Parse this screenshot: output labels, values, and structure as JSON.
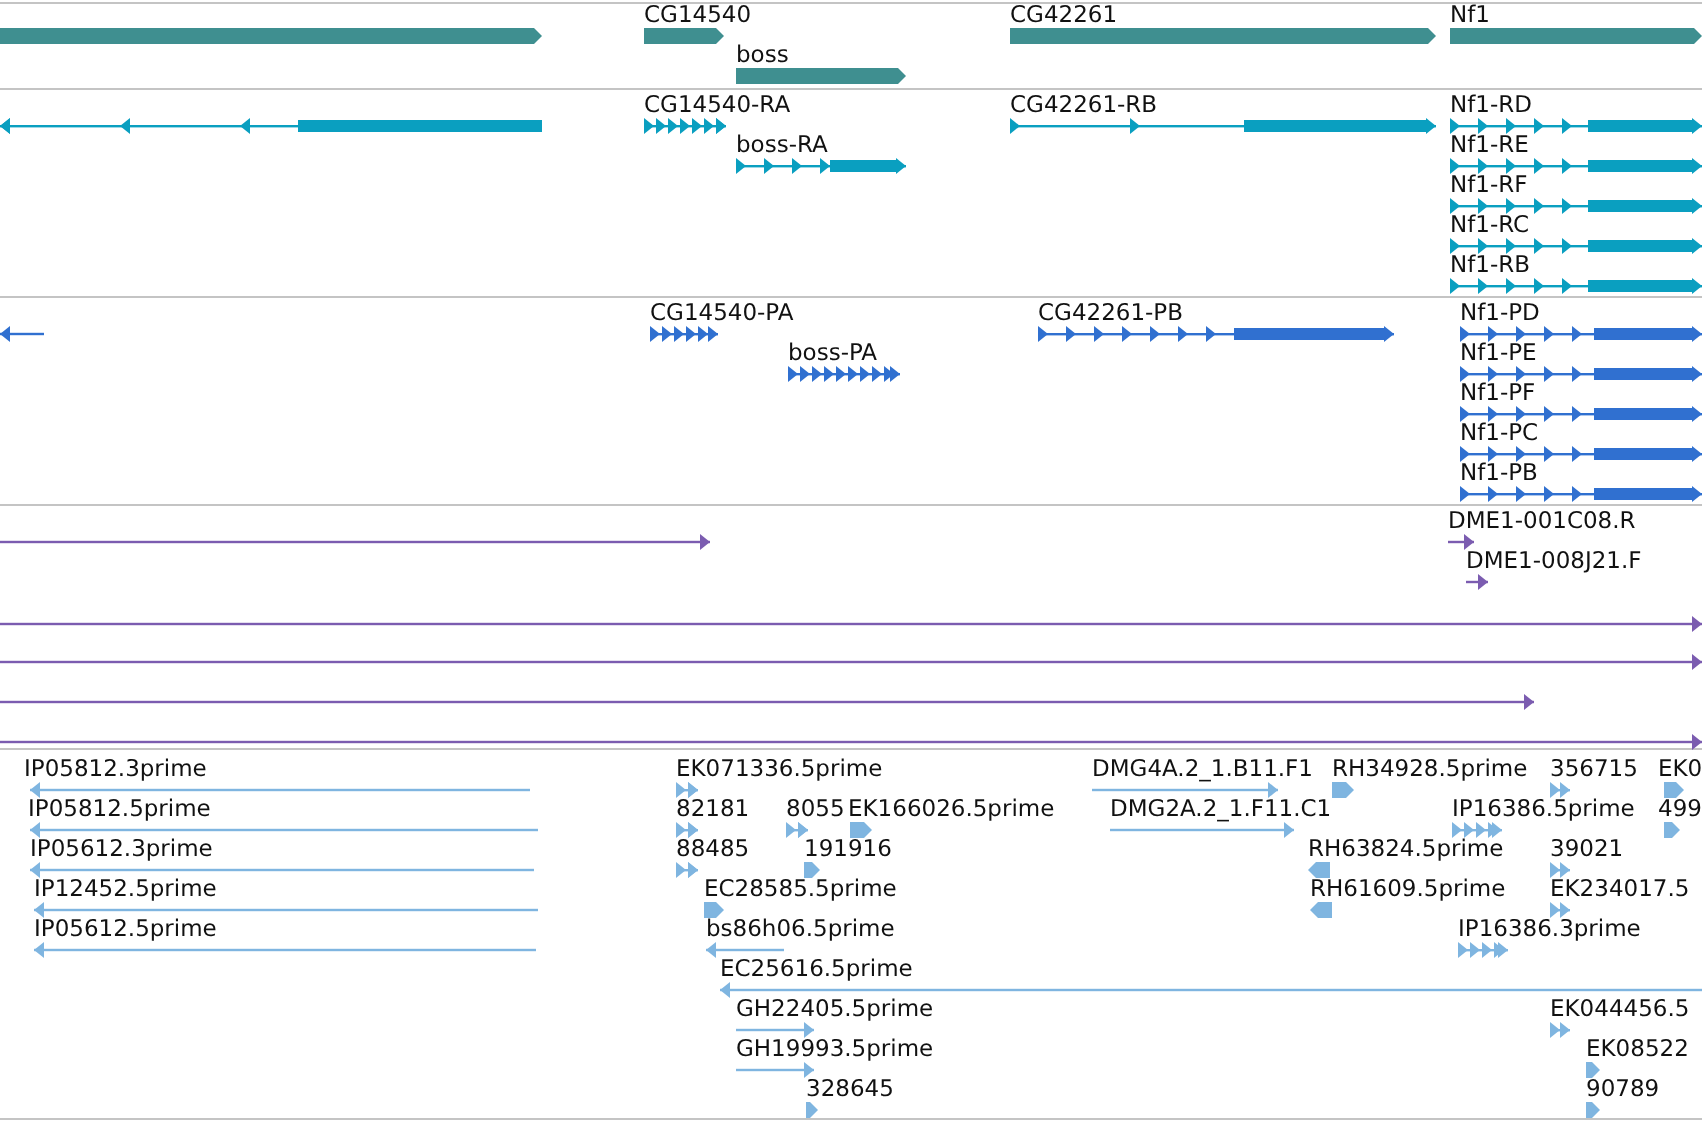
{
  "tracks": [
    {
      "color": "#3f8f90",
      "features": [
        {
          "kind": "bar",
          "reverse": false
        },
        {
          "label": "CG14540",
          "kind": "bar",
          "reverse": false
        },
        {
          "label": "boss",
          "kind": "bar",
          "reverse": false
        },
        {
          "label": "CG42261",
          "kind": "bar",
          "reverse": false
        },
        {
          "label": "Nf1",
          "kind": "bar",
          "reverse": false
        }
      ]
    },
    {
      "color": "#0a9fc0",
      "features": [
        {
          "kind": "exons",
          "reverse": true
        },
        {
          "label": "CG14540-RA",
          "kind": "exons",
          "reverse": false
        },
        {
          "label": "boss-RA",
          "kind": "exons",
          "reverse": false
        },
        {
          "label": "CG42261-RB",
          "kind": "exons",
          "reverse": false
        },
        {
          "label": "Nf1-RD",
          "kind": "exons",
          "reverse": false
        },
        {
          "label": "Nf1-RE",
          "kind": "exons",
          "reverse": false
        },
        {
          "label": "Nf1-RF",
          "kind": "exons",
          "reverse": false
        },
        {
          "label": "Nf1-RC",
          "kind": "exons",
          "reverse": false
        },
        {
          "label": "Nf1-RB",
          "kind": "exons",
          "reverse": false
        }
      ]
    },
    {
      "color": "#3070d0",
      "features": [
        {
          "kind": "line",
          "reverse": true
        },
        {
          "label": "CG14540-PA",
          "kind": "exons",
          "reverse": false
        },
        {
          "label": "boss-PA",
          "kind": "exons",
          "reverse": false
        },
        {
          "label": "CG42261-PB",
          "kind": "exons",
          "reverse": false
        },
        {
          "label": "Nf1-PD",
          "kind": "exons",
          "reverse": false
        },
        {
          "label": "Nf1-PE",
          "kind": "exons",
          "reverse": false
        },
        {
          "label": "Nf1-PF",
          "kind": "exons",
          "reverse": false
        },
        {
          "label": "Nf1-PC",
          "kind": "exons",
          "reverse": false
        },
        {
          "label": "Nf1-PB",
          "kind": "exons",
          "reverse": false
        }
      ]
    },
    {
      "color": "#7b5cb0",
      "features": [
        {
          "kind": "line",
          "reverse": false
        },
        {
          "label": "DME1-001C08.R",
          "kind": "line",
          "reverse": false
        },
        {
          "label": "DME1-008J21.F",
          "kind": "line",
          "reverse": false
        },
        {
          "kind": "line",
          "reverse": false
        },
        {
          "kind": "line",
          "reverse": false
        },
        {
          "kind": "line",
          "reverse": false
        },
        {
          "kind": "line",
          "reverse": false
        }
      ]
    },
    {
      "color": "#7fb5e0",
      "features": [
        {
          "label": "IP05812.3prime",
          "kind": "line",
          "reverse": true
        },
        {
          "label": "EK071336.5prime",
          "kind": "exons",
          "reverse": false
        },
        {
          "label": "DMG4A.2_1.B11.F1",
          "kind": "line",
          "reverse": false
        },
        {
          "label": "RH34928.5prime",
          "kind": "bar",
          "reverse": false
        },
        {
          "label": "356715",
          "kind": "exons",
          "reverse": false
        },
        {
          "label": "EK0",
          "kind": "bar",
          "reverse": false
        },
        {
          "label": "IP05812.5prime",
          "kind": "line",
          "reverse": true
        },
        {
          "label": "82181",
          "kind": "exons",
          "reverse": false
        },
        {
          "label": "8055",
          "kind": "exons",
          "reverse": false
        },
        {
          "label": "EK166026.5prime",
          "kind": "bar",
          "reverse": false
        },
        {
          "label": "DMG2A.2_1.F11.C1",
          "kind": "line",
          "reverse": false
        },
        {
          "label": "IP16386.5prime",
          "kind": "exons",
          "reverse": false
        },
        {
          "label": "499",
          "kind": "bar",
          "reverse": false
        },
        {
          "label": "IP05612.3prime",
          "kind": "line",
          "reverse": true
        },
        {
          "label": "88485",
          "kind": "exons",
          "reverse": false
        },
        {
          "label": "191916",
          "kind": "bar",
          "reverse": false
        },
        {
          "label": "RH63824.5prime",
          "kind": "bar",
          "reverse": true
        },
        {
          "label": "39021",
          "kind": "exons",
          "reverse": false
        },
        {
          "label": "IP12452.5prime",
          "kind": "line",
          "reverse": true
        },
        {
          "label": "EC28585.5prime",
          "kind": "bar",
          "reverse": false
        },
        {
          "label": "RH61609.5prime",
          "kind": "bar",
          "reverse": true
        },
        {
          "label": "EK234017.5",
          "kind": "exons",
          "reverse": false
        },
        {
          "label": "IP05612.5prime",
          "kind": "line",
          "reverse": true
        },
        {
          "label": "bs86h06.5prime",
          "kind": "line",
          "reverse": true
        },
        {
          "label": "IP16386.3prime",
          "kind": "exons",
          "reverse": false
        },
        {
          "label": "EC25616.5prime",
          "kind": "line",
          "reverse": true
        },
        {
          "label": "GH22405.5prime",
          "kind": "line",
          "reverse": false
        },
        {
          "label": "EK044456.5",
          "kind": "exons",
          "reverse": false
        },
        {
          "label": "GH19993.5prime",
          "kind": "line",
          "reverse": false
        },
        {
          "label": "EK08522",
          "kind": "bar",
          "reverse": false
        },
        {
          "label": "328645",
          "kind": "bar",
          "reverse": false
        },
        {
          "label": "90789",
          "kind": "bar",
          "reverse": false
        }
      ]
    }
  ]
}
